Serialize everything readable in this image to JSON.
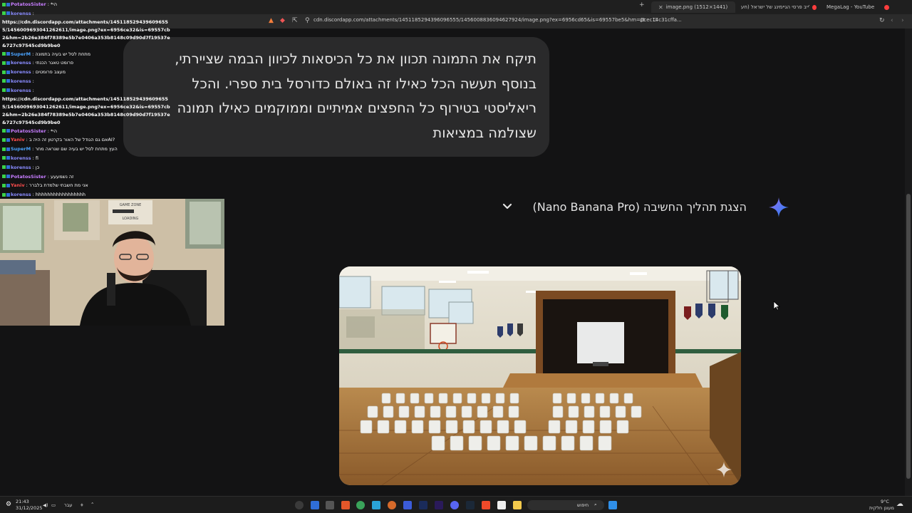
{
  "browser": {
    "tabs": [
      {
        "title": "image.png (1512×1441)",
        "active": true
      },
      {
        "title": "לייב פרסי הגיימינג של ישראל (חע...",
        "active": false
      },
      {
        "title": "MegaLag - YouTube",
        "active": false
      }
    ],
    "url": "cdn.discordapp.com/attachments/1451185294396096555/1456008836094627924/image.png?ex=6956cd65&is=69557be5&hm=0cec14c31cffa..."
  },
  "conversation": {
    "user_message": "תיקח את התמונה תכוון את כל הכיסאות לכיוון הבמה שציירתי, בנוסף תעשה הכל כאילו זה באולם כדורסל בית ספרי. והכל ריאליסטי בטירוף כל החפצים אמיתיים וממוקמים כאילו תמונה שצולמה במציאות",
    "thinking_toggle_label": "הצגת תהליך החשיבה (Nano Banana Pro)",
    "image_alt": "Generated image: school gymnasium with white plastic chairs facing a stage with a projection screen"
  },
  "chat": {
    "messages": [
      {
        "user": "PotatosSister",
        "color": "#c77dff",
        "text": "הי*"
      },
      {
        "user": "korenss",
        "color": "#8a8cff",
        "text": ""
      },
      {
        "user": "",
        "color": "#ffffff",
        "text": "https://cdn.discordapp.com/attachments/1451185294396096555/1456009693041262611/image.png?ex=6956ce32&is=69557cb2&hm=2b26e384f78389e5b7e0406a353b8148c09d90d7f19537e727c97545cd9b9be0&",
        "long": true
      },
      {
        "user": "SuperM",
        "color": "#4aa3ff",
        "text": "מתחת לסל יש בעיה בתמונה"
      },
      {
        "user": "korenss",
        "color": "#8a8cff",
        "text": "פרומט טאגר הכנתי"
      },
      {
        "user": "korenss",
        "color": "#8a8cff",
        "text": "מעצב פרומטים"
      },
      {
        "user": "korenss",
        "color": "#8a8cff",
        "text": ""
      },
      {
        "user": "korenss",
        "color": "#8a8cff",
        "text": ""
      },
      {
        "user": "",
        "color": "#ffffff",
        "text": "https://cdn.discordapp.com/attachments/1451185294396096555/1456009693041262611/image.png?ex=6956ce32&is=69557cb2&hm=2b26e384f78389e5b7e0406a353b8148c09d90d7f19537e727c97545cd9b9be0&",
        "long": true
      },
      {
        "user": "PotatosSister",
        "color": "#c77dff",
        "text": "הי*"
      },
      {
        "user": "Yaniv",
        "color": "#ff4d4d",
        "text": "?AIאם גם הגודל של האור בקרטון זה היה ב"
      },
      {
        "user": "SuperM",
        "color": "#4aa3ff",
        "text": "העץ מתחת לסל יש בעיה שם שנראה מחר"
      },
      {
        "user": "korenss",
        "color": "#8a8cff",
        "text": "fi"
      },
      {
        "user": "korenss",
        "color": "#8a8cff",
        "text": "כן"
      },
      {
        "user": "PotatosSister",
        "color": "#c77dff",
        "text": "זה נשמעעע"
      },
      {
        "user": "Yaniv",
        "color": "#ff4d4d",
        "text": "אני מת חשבתי שלמדת בלברר"
      },
      {
        "user": "korenss",
        "color": "#8a8cff",
        "text": "hhhhhhhhhhhhhhhhh"
      }
    ]
  },
  "webcam": {
    "sign_line1": "GAME ZONE",
    "sign_line2": "LOADING"
  },
  "taskbar": {
    "time": "21:43",
    "date": "31/12/2025",
    "lang": "עבר",
    "search_placeholder": "חיפוש",
    "weather_temp": "9°C",
    "weather_desc": "מעונן חלקית"
  },
  "colors": {
    "page_bg": "#131314",
    "bubble_bg": "#2a2a2b",
    "gemini_blue": "#4c8df6"
  }
}
